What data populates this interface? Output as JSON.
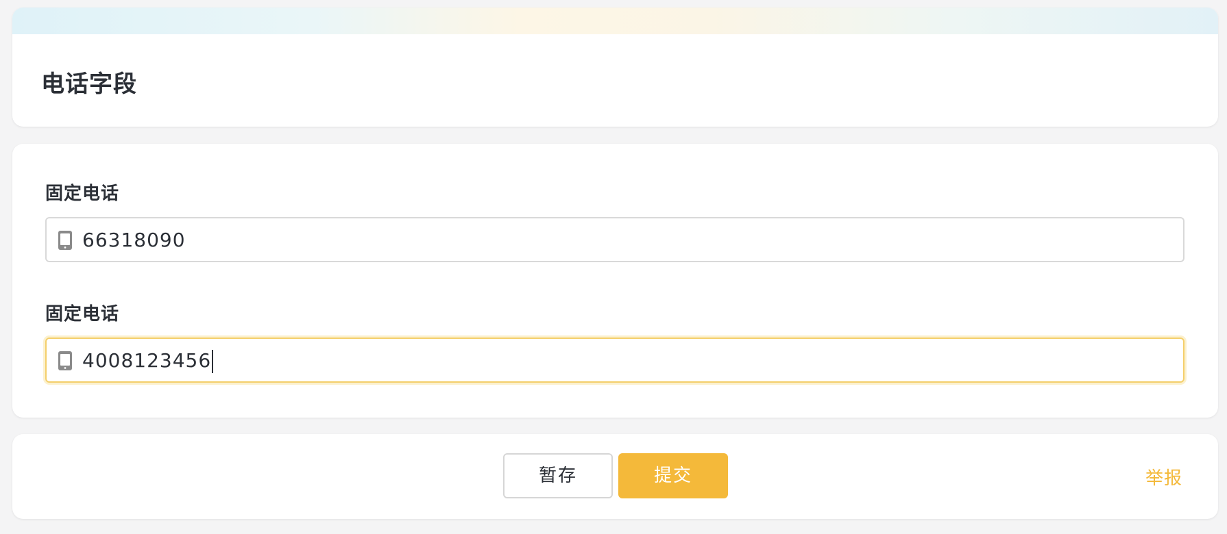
{
  "header": {
    "title": "电话字段"
  },
  "form": {
    "fields": [
      {
        "label": "固定电话",
        "value": "66318090",
        "icon": "mobile-phone-icon"
      },
      {
        "label": "固定电话",
        "value": "4008123456",
        "icon": "mobile-phone-icon"
      }
    ]
  },
  "actions": {
    "save_label": "暂存",
    "submit_label": "提交",
    "report_label": "举报"
  },
  "colors": {
    "accent": "#f4b93a",
    "focus_border": "#f4cf6b",
    "text": "#2b2f36",
    "background": "#f4f4f5"
  }
}
